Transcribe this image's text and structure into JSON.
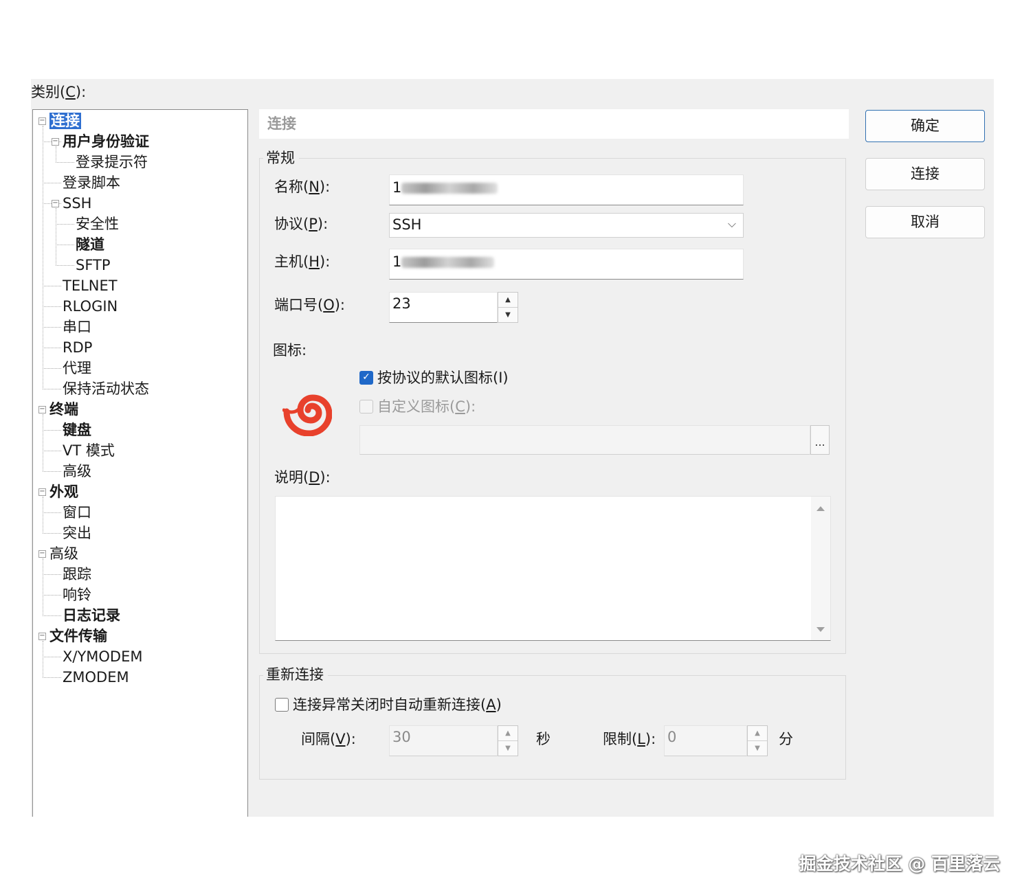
{
  "category_label_pre": "类别(",
  "category_label_key": "C",
  "category_label_post": "):",
  "tree": [
    {
      "label": "连接",
      "depth": 0,
      "bold": true,
      "selected": true,
      "expander": "−"
    },
    {
      "label": "用户身份验证",
      "depth": 1,
      "bold": true,
      "expander": "−"
    },
    {
      "label": "登录提示符",
      "depth": 2,
      "bold": false
    },
    {
      "label": "登录脚本",
      "depth": 1,
      "bold": false
    },
    {
      "label": "SSH",
      "depth": 1,
      "bold": false,
      "expander": "−"
    },
    {
      "label": "安全性",
      "depth": 2,
      "bold": false
    },
    {
      "label": "隧道",
      "depth": 2,
      "bold": true
    },
    {
      "label": "SFTP",
      "depth": 2,
      "bold": false
    },
    {
      "label": "TELNET",
      "depth": 1,
      "bold": false
    },
    {
      "label": "RLOGIN",
      "depth": 1,
      "bold": false
    },
    {
      "label": "串口",
      "depth": 1,
      "bold": false
    },
    {
      "label": "RDP",
      "depth": 1,
      "bold": false
    },
    {
      "label": "代理",
      "depth": 1,
      "bold": false
    },
    {
      "label": "保持活动状态",
      "depth": 1,
      "bold": false
    },
    {
      "label": "终端",
      "depth": 0,
      "bold": true,
      "expander": "−"
    },
    {
      "label": "键盘",
      "depth": 1,
      "bold": true
    },
    {
      "label": "VT 模式",
      "depth": 1,
      "bold": false
    },
    {
      "label": "高级",
      "depth": 1,
      "bold": false
    },
    {
      "label": "外观",
      "depth": 0,
      "bold": true,
      "expander": "−"
    },
    {
      "label": "窗口",
      "depth": 1,
      "bold": false
    },
    {
      "label": "突出",
      "depth": 1,
      "bold": false
    },
    {
      "label": "高级",
      "depth": 0,
      "bold": false,
      "expander": "−"
    },
    {
      "label": "跟踪",
      "depth": 1,
      "bold": false
    },
    {
      "label": "响铃",
      "depth": 1,
      "bold": false
    },
    {
      "label": "日志记录",
      "depth": 1,
      "bold": true
    },
    {
      "label": "文件传输",
      "depth": 0,
      "bold": true,
      "expander": "−"
    },
    {
      "label": "X/YMODEM",
      "depth": 1,
      "bold": false
    },
    {
      "label": "ZMODEM",
      "depth": 1,
      "bold": false
    }
  ],
  "panel": {
    "header": "连接",
    "general": {
      "title": "常规",
      "name_label_pre": "名称(",
      "name_label_key": "N",
      "name_label_post": "):",
      "name_value": "1",
      "protocol_label_pre": "协议(",
      "protocol_label_key": "P",
      "protocol_label_post": "):",
      "protocol_value": "SSH",
      "host_label_pre": "主机(",
      "host_label_key": "H",
      "host_label_post": "):",
      "host_value": "1",
      "port_label_pre": "端口号(",
      "port_label_key": "O",
      "port_label_post": "):",
      "port_value": "23",
      "icon_label": "图标:",
      "default_icon_label": "按协议的默认图标(I)",
      "default_icon_checked": true,
      "custom_icon_label_pre": "自定义图标(",
      "custom_icon_label_key": "C",
      "custom_icon_label_post": "):",
      "custom_icon_checked": false,
      "browse_label": "...",
      "desc_label_pre": "说明(",
      "desc_label_key": "D",
      "desc_label_post": "):",
      "desc_value": ""
    },
    "reconnect": {
      "title": "重新连接",
      "auto_label_pre": "连接异常关闭时自动重新连接(",
      "auto_label_key": "A",
      "auto_label_post": ")",
      "auto_checked": false,
      "interval_label_pre": "间隔(",
      "interval_label_key": "V",
      "interval_label_post": "):",
      "interval_value": "30",
      "interval_unit": "秒",
      "limit_label_pre": "限制(",
      "limit_label_key": "L",
      "limit_label_post": "):",
      "limit_value": "0",
      "limit_unit": "分"
    }
  },
  "buttons": {
    "ok": "确定",
    "connect": "连接",
    "cancel": "取消"
  },
  "watermark": "掘金技术社区 @ 百里落云",
  "colors": {
    "accent": "#1f68c8",
    "selection": "#2f6fd0",
    "dialog_bg": "#f0f0f0",
    "icon_red": "#e8412c"
  }
}
